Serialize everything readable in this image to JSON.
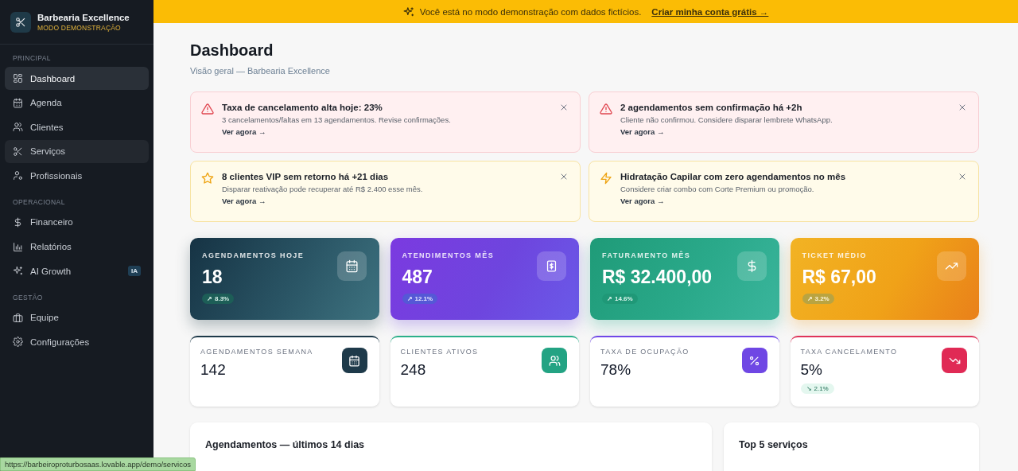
{
  "sidebar": {
    "brand": {
      "name": "Barbearia Excellence",
      "subtitle": "MODO DEMONSTRAÇÃO"
    },
    "sections": [
      {
        "title": "PRINCIPAL",
        "items": [
          {
            "label": "Dashboard",
            "selected": true,
            "hovered": false
          },
          {
            "label": "Agenda",
            "selected": false,
            "hovered": false
          },
          {
            "label": "Clientes",
            "selected": false,
            "hovered": false
          },
          {
            "label": "Serviços",
            "selected": false,
            "hovered": true
          },
          {
            "label": "Profissionais",
            "selected": false,
            "hovered": false
          }
        ]
      },
      {
        "title": "OPERACIONAL",
        "items": [
          {
            "label": "Financeiro",
            "selected": false,
            "hovered": false
          },
          {
            "label": "Relatórios",
            "selected": false,
            "hovered": false
          },
          {
            "label": "AI Growth",
            "selected": false,
            "hovered": false,
            "badge": "IA"
          }
        ]
      },
      {
        "title": "GESTÃO",
        "items": [
          {
            "label": "Equipe",
            "selected": false,
            "hovered": false
          },
          {
            "label": "Configurações",
            "selected": false,
            "hovered": false
          }
        ]
      }
    ]
  },
  "banner": {
    "text": "Você está no modo demonstração com dados fictícios.",
    "link": "Criar minha conta grátis →"
  },
  "page": {
    "title": "Dashboard",
    "subtitle": "Visão geral — Barbearia Excellence"
  },
  "alerts": [
    {
      "kind": "danger",
      "title": "Taxa de cancelamento alta hoje: 23%",
      "text": "3 cancelamentos/faltas em 13 agendamentos. Revise confirmações.",
      "action": "Ver agora →"
    },
    {
      "kind": "danger",
      "title": "2 agendamentos sem confirmação há +2h",
      "text": "Cliente não confirmou. Considere disparar lembrete WhatsApp.",
      "action": "Ver agora →"
    },
    {
      "kind": "warning",
      "title": "8 clientes VIP sem retorno há +21 dias",
      "text": "Disparar reativação pode recuperar até R$ 2.400 esse mês.",
      "action": "Ver agora →"
    },
    {
      "kind": "warning",
      "title": "Hidratação Capilar com zero agendamentos no mês",
      "text": "Considere criar combo com Corte Premium ou promoção.",
      "action": "Ver agora →"
    }
  ],
  "kpis": [
    {
      "kind": "slate",
      "label": "AGENDAMENTOS HOJE",
      "value": "18",
      "trend": {
        "arrow": "↗",
        "value": "8.3%"
      }
    },
    {
      "kind": "violet",
      "label": "ATENDIMENTOS MÊS",
      "value": "487",
      "trend": {
        "arrow": "↗",
        "value": "12.1%"
      }
    },
    {
      "kind": "emerald",
      "label": "FATURAMENTO MÊS",
      "value": "R$ 32.400,00",
      "trend": {
        "arrow": "↗",
        "value": "14.6%"
      }
    },
    {
      "kind": "amber",
      "label": "TICKET MÉDIO",
      "value": "R$ 67,00",
      "trend": {
        "arrow": "↗",
        "value": "3.2%"
      }
    }
  ],
  "stats": [
    {
      "kind": "slate",
      "label": "AGENDAMENTOS SEMANA",
      "value": "142"
    },
    {
      "kind": "emerald",
      "label": "CLIENTES ATIVOS",
      "value": "248"
    },
    {
      "kind": "violet",
      "label": "TAXA DE OCUPAÇÃO",
      "value": "78%"
    },
    {
      "kind": "rose",
      "label": "TAXA CANCELAMENTO",
      "value": "5%",
      "trend": {
        "arrow": "↘",
        "value": "2.1%"
      }
    }
  ],
  "panels": [
    {
      "title": "Agendamentos — últimos 14 dias"
    },
    {
      "title": "Top 5 serviços"
    }
  ],
  "status_url": "https://barbeiroproturbosaas.lovable.app/demo/servicos"
}
